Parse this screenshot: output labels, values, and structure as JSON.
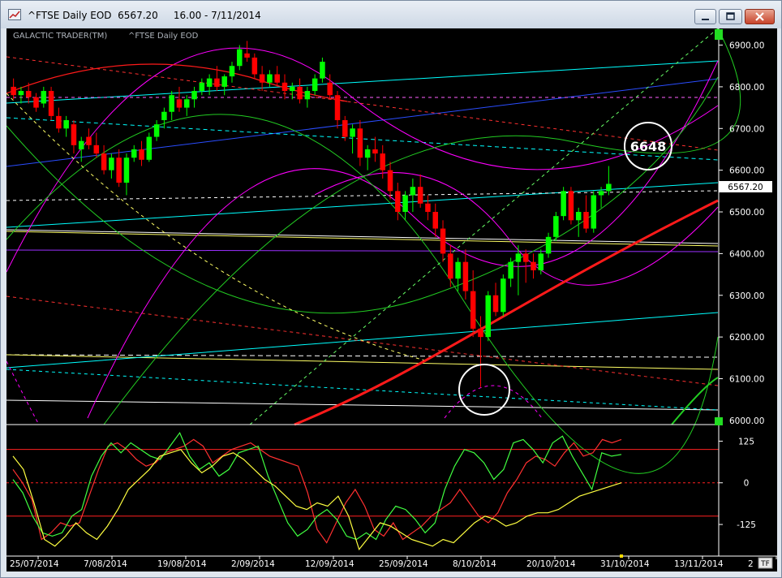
{
  "window": {
    "title": "^FTSE Daily EOD  6567.20     16.00 - 7/11/2014",
    "min_icon": "minimize-icon",
    "max_icon": "maximize-icon",
    "close_icon": "close-icon"
  },
  "chart_header": {
    "brand": "GALACTIC TRADER(TM)",
    "symbol_label": "^FTSE Daily EOD"
  },
  "annotations": {
    "target_value": "6648",
    "last_price": "6567.20",
    "tf_badge": "TF"
  },
  "colors": {
    "background": "#000000",
    "up_candle": "#00ff00",
    "down_candle": "#ff0000",
    "price_box": "#ffffff",
    "highlight_circle": "#ffffff"
  },
  "chart_data": [
    {
      "type": "candlestick",
      "title": "",
      "ylim": [
        5990,
        6940
      ],
      "y_ticks": [
        "6900.00",
        "6800.00",
        "6700.00",
        "6600.00",
        "6500.00",
        "6400.00",
        "6300.00",
        "6200.00",
        "6100.00",
        "6000.00"
      ],
      "x_ticks": [
        "25/07/2014",
        "7/08/2014",
        "19/08/2014",
        "2/09/2014",
        "12/09/2014",
        "25/09/2014",
        "8/10/2014",
        "20/10/2014",
        "31/10/2014",
        "13/11/2014",
        "2"
      ],
      "last_close": 6567.2,
      "series": [
        {
          "name": "",
          "values": [
            [
              6800,
              6820,
              6770,
              6780
            ],
            [
              6780,
              6800,
              6760,
              6790
            ],
            [
              6790,
              6810,
              6760,
              6775
            ],
            [
              6775,
              6785,
              6740,
              6750
            ],
            [
              6760,
              6800,
              6750,
              6790
            ],
            [
              6790,
              6800,
              6720,
              6730
            ],
            [
              6730,
              6750,
              6690,
              6700
            ],
            [
              6700,
              6730,
              6680,
              6720
            ],
            [
              6710,
              6720,
              6640,
              6660
            ],
            [
              6650,
              6680,
              6620,
              6670
            ],
            [
              6680,
              6700,
              6650,
              6660
            ],
            [
              6660,
              6690,
              6630,
              6640
            ],
            [
              6640,
              6660,
              6590,
              6600
            ],
            [
              6600,
              6640,
              6580,
              6630
            ],
            [
              6630,
              6650,
              6560,
              6570
            ],
            [
              6570,
              6640,
              6540,
              6630
            ],
            [
              6630,
              6660,
              6620,
              6650
            ],
            [
              6650,
              6670,
              6610,
              6625
            ],
            [
              6625,
              6690,
              6620,
              6680
            ],
            [
              6680,
              6720,
              6670,
              6710
            ],
            [
              6720,
              6750,
              6700,
              6740
            ],
            [
              6740,
              6790,
              6720,
              6780
            ],
            [
              6770,
              6800,
              6740,
              6750
            ],
            [
              6750,
              6780,
              6730,
              6770
            ],
            [
              6770,
              6800,
              6750,
              6790
            ],
            [
              6790,
              6820,
              6780,
              6810
            ],
            [
              6800,
              6830,
              6780,
              6820
            ],
            [
              6820,
              6850,
              6790,
              6800
            ],
            [
              6800,
              6830,
              6780,
              6825
            ],
            [
              6825,
              6860,
              6810,
              6850
            ],
            [
              6850,
              6900,
              6840,
              6890
            ],
            [
              6880,
              6910,
              6860,
              6870
            ],
            [
              6870,
              6880,
              6820,
              6830
            ],
            [
              6830,
              6850,
              6790,
              6810
            ],
            [
              6810,
              6840,
              6800,
              6830
            ],
            [
              6830,
              6850,
              6800,
              6810
            ],
            [
              6810,
              6830,
              6770,
              6790
            ],
            [
              6790,
              6810,
              6770,
              6800
            ],
            [
              6800,
              6820,
              6760,
              6770
            ],
            [
              6770,
              6800,
              6750,
              6790
            ],
            [
              6790,
              6830,
              6780,
              6820
            ],
            [
              6820,
              6870,
              6810,
              6860
            ],
            [
              6810,
              6830,
              6770,
              6780
            ],
            [
              6780,
              6790,
              6700,
              6720
            ],
            [
              6720,
              6730,
              6670,
              6680
            ],
            [
              6680,
              6710,
              6640,
              6700
            ],
            [
              6700,
              6720,
              6610,
              6630
            ],
            [
              6630,
              6660,
              6600,
              6650
            ],
            [
              6650,
              6680,
              6620,
              6640
            ],
            [
              6640,
              6660,
              6580,
              6600
            ],
            [
              6600,
              6620,
              6530,
              6550
            ],
            [
              6550,
              6570,
              6480,
              6500
            ],
            [
              6500,
              6550,
              6480,
              6540
            ],
            [
              6540,
              6580,
              6500,
              6560
            ],
            [
              6560,
              6590,
              6510,
              6520
            ],
            [
              6520,
              6540,
              6480,
              6500
            ],
            [
              6500,
              6520,
              6440,
              6460
            ],
            [
              6460,
              6480,
              6380,
              6400
            ],
            [
              6400,
              6420,
              6320,
              6340
            ],
            [
              6340,
              6390,
              6310,
              6380
            ],
            [
              6380,
              6410,
              6290,
              6310
            ],
            [
              6310,
              6360,
              6200,
              6220
            ],
            [
              6220,
              6250,
              6080,
              6200
            ],
            [
              6200,
              6310,
              6190,
              6300
            ],
            [
              6300,
              6330,
              6250,
              6260
            ],
            [
              6260,
              6350,
              6250,
              6340
            ],
            [
              6340,
              6390,
              6320,
              6380
            ],
            [
              6380,
              6420,
              6300,
              6400
            ],
            [
              6400,
              6410,
              6330,
              6380
            ],
            [
              6380,
              6400,
              6340,
              6360
            ],
            [
              6360,
              6410,
              6350,
              6400
            ],
            [
              6400,
              6450,
              6390,
              6440
            ],
            [
              6440,
              6500,
              6430,
              6490
            ],
            [
              6490,
              6560,
              6480,
              6550
            ],
            [
              6550,
              6560,
              6470,
              6480
            ],
            [
              6480,
              6510,
              6440,
              6500
            ],
            [
              6500,
              6540,
              6450,
              6460
            ],
            [
              6460,
              6550,
              6450,
              6540
            ],
            [
              6540,
              6560,
              6510,
              6550
            ],
            [
              6550,
              6610,
              6540,
              6567.2
            ]
          ]
        }
      ]
    },
    {
      "type": "line",
      "title": "",
      "ylim": [
        -215,
        165
      ],
      "y_ticks": [
        "125",
        "0",
        "-125"
      ],
      "reference_lines": [
        100,
        0,
        -100
      ],
      "series": [
        {
          "name": "",
          "color": "#ff3030",
          "values": [
            40,
            0,
            -50,
            -170,
            -150,
            -120,
            -130,
            -120,
            -40,
            40,
            110,
            120,
            100,
            70,
            50,
            60,
            90,
            100,
            110,
            130,
            110,
            60,
            80,
            100,
            110,
            120,
            100,
            80,
            70,
            60,
            50,
            -30,
            -140,
            -180,
            -120,
            -60,
            -20,
            -70,
            -140,
            -160,
            -120,
            -170,
            -150,
            -130,
            -100,
            -80,
            -60,
            -20,
            -60,
            -100,
            -120,
            -90,
            -30,
            10,
            60,
            80,
            70,
            50,
            90,
            120,
            80,
            90,
            130,
            120,
            130
          ]
        },
        {
          "name": "",
          "color": "#40ff40",
          "values": [
            10,
            -30,
            -100,
            -150,
            -160,
            -150,
            -100,
            -80,
            20,
            80,
            120,
            90,
            120,
            100,
            80,
            70,
            110,
            150,
            80,
            40,
            60,
            20,
            40,
            90,
            100,
            110,
            20,
            -50,
            -120,
            -160,
            -140,
            -100,
            -80,
            -110,
            -160,
            -170,
            -150,
            -170,
            -110,
            -70,
            -80,
            -110,
            -150,
            -120,
            -20,
            50,
            100,
            90,
            60,
            10,
            40,
            120,
            130,
            100,
            60,
            120,
            140,
            80,
            30,
            -20,
            90,
            80,
            85
          ]
        },
        {
          "name": "",
          "color": "#ffff40",
          "values": [
            80,
            40,
            -60,
            -170,
            -190,
            -160,
            -120,
            -150,
            -170,
            -130,
            -80,
            -20,
            10,
            40,
            80,
            90,
            100,
            60,
            30,
            50,
            80,
            90,
            70,
            40,
            10,
            -10,
            -40,
            -70,
            -80,
            -60,
            -70,
            -40,
            -100,
            -200,
            -160,
            -120,
            -130,
            -150,
            -170,
            -180,
            -190,
            -170,
            -180,
            -150,
            -120,
            -100,
            -110,
            -130,
            -120,
            -100,
            -90,
            -90,
            -80,
            -60,
            -40,
            -30,
            -20,
            -10,
            0
          ]
        }
      ]
    }
  ]
}
